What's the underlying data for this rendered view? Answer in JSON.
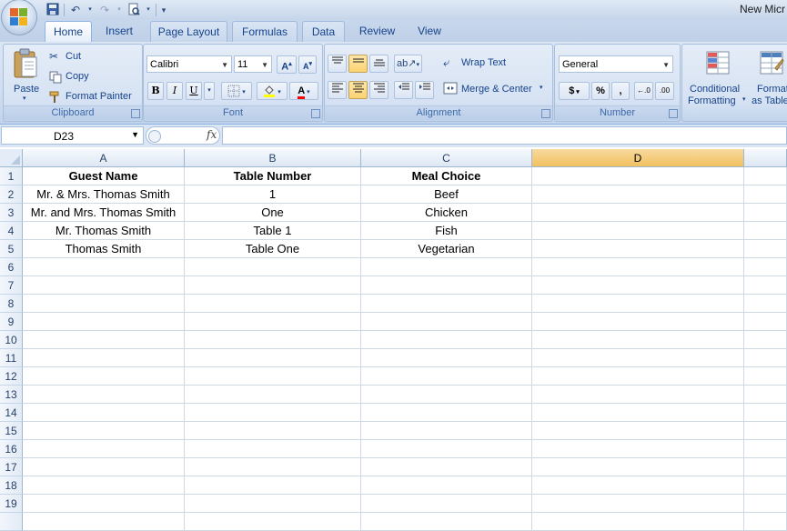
{
  "window": {
    "title": "New Micr"
  },
  "ribbon_tabs": [
    "Home",
    "Insert",
    "Page Layout",
    "Formulas",
    "Data",
    "Review",
    "View"
  ],
  "clipboard": {
    "paste": "Paste",
    "cut": "Cut",
    "copy": "Copy",
    "format_painter": "Format Painter",
    "label": "Clipboard"
  },
  "font": {
    "family": "Calibri",
    "size": "11",
    "bold": "B",
    "italic": "I",
    "underline": "U",
    "label": "Font"
  },
  "alignment": {
    "wrap_text": "Wrap Text",
    "merge_center": "Merge & Center",
    "label": "Alignment"
  },
  "number": {
    "format": "General",
    "currency": "$",
    "percent": "%",
    "comma": ",",
    "label": "Number"
  },
  "styles": {
    "conditional_1": "Conditional",
    "conditional_2": "Formatting",
    "format_1": "Format",
    "format_2": "as Table"
  },
  "formula_bar": {
    "name_box": "D23",
    "fx": "fx",
    "value": ""
  },
  "columns": [
    "A",
    "B",
    "C",
    "D"
  ],
  "selected_column": "D",
  "rows": [
    "1",
    "2",
    "3",
    "4",
    "5",
    "6",
    "7",
    "8",
    "9",
    "10",
    "11",
    "12",
    "13",
    "14",
    "15",
    "16",
    "17",
    "18",
    "19"
  ],
  "table": {
    "headers": [
      "Guest Name",
      "Table Number",
      "Meal Choice"
    ],
    "rows": [
      [
        "Mr. & Mrs. Thomas Smith",
        "1",
        "Beef"
      ],
      [
        "Mr. and Mrs. Thomas Smith",
        "One",
        "Chicken"
      ],
      [
        "Mr. Thomas Smith",
        "Table 1",
        "Fish"
      ],
      [
        "Thomas Smith",
        "Table One",
        "Vegetarian"
      ]
    ]
  }
}
